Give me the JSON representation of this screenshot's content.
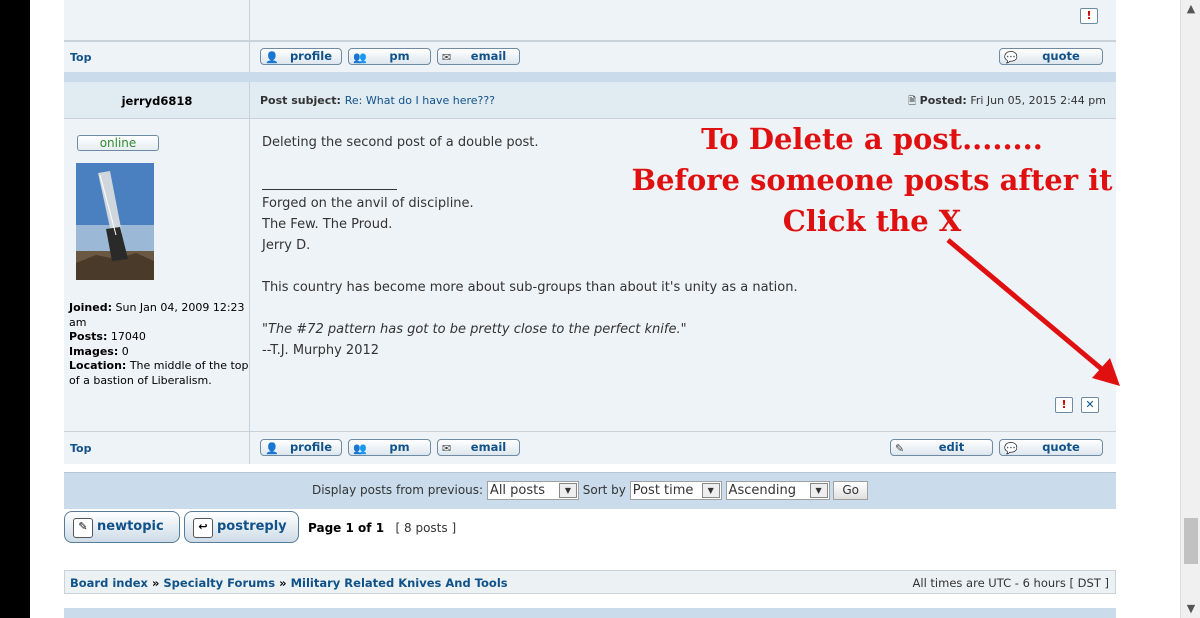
{
  "prev_post": {
    "top_link": "Top",
    "buttons": {
      "profile": "profile",
      "pm": "pm",
      "email": "email",
      "quote": "quote"
    }
  },
  "post": {
    "author": "jerryd6818",
    "subject_label": "Post subject:",
    "subject": "Re: What do I have here???",
    "posted_label": "Posted:",
    "posted_date": "Fri Jun 05, 2015 2:44 pm",
    "online_label": "online",
    "profile": {
      "joined_label": "Joined:",
      "joined": "Sun Jan 04, 2009 12:23 am",
      "posts_label": "Posts:",
      "posts": "17040",
      "images_label": "Images:",
      "images": "0",
      "location_label": "Location:",
      "location": "The middle of the top of a bastion of Liberalism."
    },
    "body": "Deleting the second post of a double post.",
    "signature": {
      "line1": "Forged on the anvil of discipline.",
      "line2": "The Few. The Proud.",
      "line3": "Jerry D.",
      "line4": "This country has become more about sub-groups than about it's unity as a nation.",
      "quote": "\"The #72 pattern has got to be pretty close to the perfect knife.\"",
      "quote_author": "--T.J. Murphy 2012"
    },
    "top_link": "Top",
    "buttons": {
      "profile": "profile",
      "pm": "pm",
      "email": "email",
      "edit": "edit",
      "quote": "quote"
    }
  },
  "annotation": {
    "line1": "To Delete a post........",
    "line2": "Before someone posts after it",
    "line3": "Click the X"
  },
  "display_bar": {
    "label": "Display posts from previous:",
    "days_value": "All posts",
    "sort_label": "Sort by",
    "sort_value": "Post time",
    "order_value": "Ascending",
    "go_label": "Go"
  },
  "actions": {
    "new_topic": "newtopic",
    "post_reply": "postreply",
    "page_prefix": "Page",
    "page_current": "1",
    "page_of": "of",
    "page_total": "1",
    "post_count": "[ 8 posts ]"
  },
  "breadcrumb": {
    "items": [
      "Board index",
      "Specialty Forums",
      "Military Related Knives And Tools"
    ],
    "separator": "»"
  },
  "timezone": "All times are UTC - 6 hours [ DST ]",
  "colors": {
    "link": "#105289",
    "annotation": "#e01010",
    "online": "#2e8b2e"
  }
}
